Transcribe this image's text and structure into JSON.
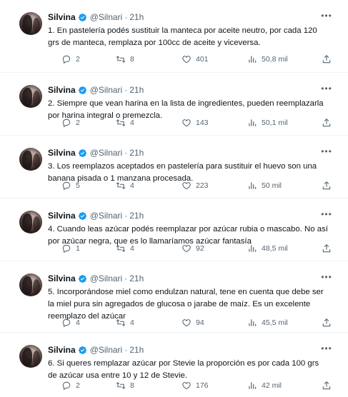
{
  "tweets": [
    {
      "name": "Silvina",
      "handle": "@Silnari",
      "time": "21h",
      "text": "1. En pastelería podés sustituir la manteca por aceite neutro, por cada 120 grs de manteca, remplaza por 100cc de aceite y viceversa.",
      "replies": "2",
      "retweets": "8",
      "likes": "401",
      "views": "50,8 mil"
    },
    {
      "name": "Silvina",
      "handle": "@Silnari",
      "time": "21h",
      "text": "2. Siempre que vean harina en la lista de ingredientes, pueden reemplazarla por harina integral o premezcla.",
      "replies": "2",
      "retweets": "4",
      "likes": "143",
      "views": "50,1 mil"
    },
    {
      "name": "Silvina",
      "handle": "@Silnari",
      "time": "21h",
      "text": "3. Los reemplazos aceptados en pastelería para sustituir el huevo son una banana pisada o 1 manzana procesada.",
      "replies": "5",
      "retweets": "4",
      "likes": "223",
      "views": "50 mil"
    },
    {
      "name": "Silvina",
      "handle": "@Silnari",
      "time": "21h",
      "text": "4. Cuando leas azúcar podés reemplazar por azúcar rubia o mascabo. No así por azúcar negra, que es lo llamaríamos azúcar fantasía",
      "replies": "1",
      "retweets": "4",
      "likes": "92",
      "views": "48,5 mil"
    },
    {
      "name": "Silvina",
      "handle": "@Silnari",
      "time": "21h",
      "text": "5. Incorporándose miel como endulzan natural, tene en cuenta que debe ser la miel pura sin agregados  de glucosa o jarabe de maíz. Es un excelente reemplazo del azúcar",
      "replies": "4",
      "retweets": "4",
      "likes": "94",
      "views": "45,5 mil"
    },
    {
      "name": "Silvina",
      "handle": "@Silnari",
      "time": "21h",
      "text": "6. Si queres remplazar azúcar  por Stevie la proporción es por cada 100 grs de azúcar usa entre 10 y 12 de Stevie.",
      "replies": "2",
      "retweets": "8",
      "likes": "176",
      "views": "42 mil"
    }
  ],
  "icons": {
    "verified": "verified-badge-icon",
    "more": "more-options-icon",
    "reply": "reply-icon",
    "retweet": "retweet-icon",
    "like": "heart-icon",
    "views": "views-chart-icon",
    "share": "share-icon"
  },
  "colors": {
    "verified": "#1d9bf0",
    "text": "#0f1419",
    "muted": "#536471",
    "divider": "#eff3f4"
  }
}
